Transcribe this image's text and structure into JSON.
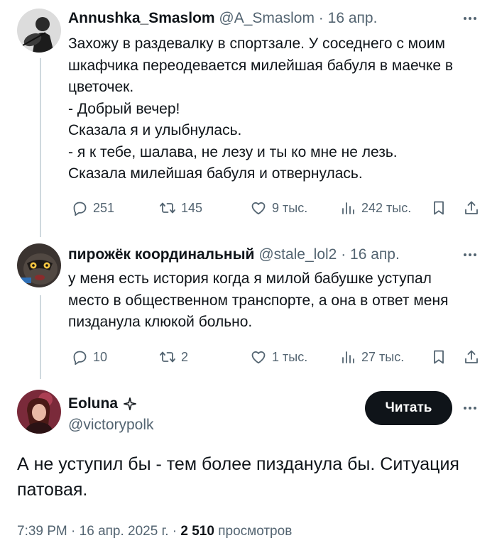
{
  "tweet1": {
    "display_name": "Annushka_Smaslom",
    "handle": "@A_Smaslom",
    "separator": "·",
    "date": "16 апр.",
    "text": "Захожу в раздевалку в спортзале. У соседнего с моим\nшкафчика переодевается милейшая бабуля в маечке в\nцветочек.\n- Добрый вечер!\nСказала я и улыбнулась.\n- я к тебе, шалава, не лезу и ты ко мне не лезь.\nСказала милейшая бабуля и отвернулась.",
    "replies": "251",
    "reposts": "145",
    "likes": "9 тыс.",
    "views": "242 тыс."
  },
  "tweet2": {
    "display_name": "пирожёк координальный",
    "handle": "@stale_lol2",
    "separator": "·",
    "date": "16 апр.",
    "text": "у меня есть история когда я милой бабушке уступал\nместо в общественном транспорте, а она в ответ меня\nпизданула клюкой больно.",
    "replies": "10",
    "reposts": "2",
    "likes": "1 тыс.",
    "views": "27 тыс."
  },
  "main_tweet": {
    "display_name": "Eoluna",
    "handle": "@victorypolk",
    "read_button_label": "Читать",
    "text": "А не уступил бы - тем более пизданула бы. Ситуация патовая.",
    "time": "7:39 PM",
    "separator": "·",
    "date": "16 апр. 2025 г.",
    "views_count": "2 510",
    "views_label": "просмотров"
  },
  "icons": {
    "reply": "reply-icon",
    "repost": "repost-icon",
    "like": "like-icon",
    "views": "views-icon",
    "bookmark": "bookmark-icon",
    "share": "share-icon",
    "more": "more-icon",
    "badge": "sparkle-badge-icon"
  },
  "colors": {
    "text": "#0f1419",
    "secondary": "#536471",
    "thread_line": "#cfd9de",
    "button_bg": "#0f1419",
    "button_text": "#ffffff"
  }
}
